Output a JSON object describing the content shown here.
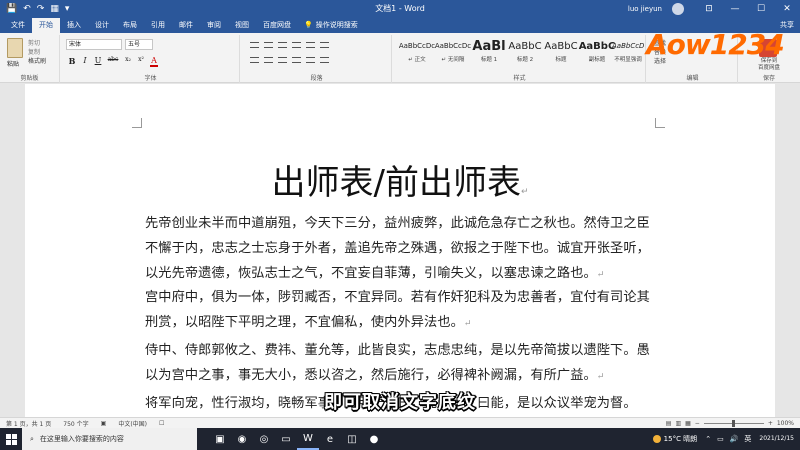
{
  "app": {
    "doc_title": "文档1 - Word",
    "user_name": "luo jieyun"
  },
  "window_buttons": {
    "ribbon_display": "⊡",
    "minimize": "—",
    "maximize": "☐",
    "close": "✕"
  },
  "quick_access": {
    "save": "💾",
    "undo": "↶",
    "redo": "↷",
    "touch": "▦",
    "customize": "▾"
  },
  "tabs": [
    "文件",
    "开始",
    "插入",
    "设计",
    "布局",
    "引用",
    "邮件",
    "审阅",
    "视图",
    "百度网盘"
  ],
  "active_tab": "开始",
  "tell_me": "操作说明搜索",
  "share": "共享",
  "ribbon": {
    "clipboard": {
      "label": "剪贴板",
      "paste": "粘贴",
      "cut": "剪切",
      "copy": "复制",
      "format_painter": "格式刷"
    },
    "font": {
      "label": "字体",
      "font_name": "宋体",
      "font_size": "五号",
      "bold": "B",
      "italic": "I",
      "underline": "U",
      "strike": "abc",
      "sub": "x₂",
      "sup": "x²",
      "clear": "A"
    },
    "paragraph": {
      "label": "段落"
    },
    "styles": {
      "label": "样式",
      "items": [
        {
          "sample": "AaBbCcDc",
          "name": "↵ 正文"
        },
        {
          "sample": "AaBbCcDc",
          "name": "↵ 无间隔"
        },
        {
          "sample": "AaBl",
          "name": "标题 1"
        },
        {
          "sample": "AaBbC",
          "name": "标题 2"
        },
        {
          "sample": "AaBbC",
          "name": "标题"
        },
        {
          "sample": "AaBbC",
          "name": "副标题"
        },
        {
          "sample": "AaBbCcD",
          "name": "不明显强调"
        }
      ]
    },
    "editing": {
      "label": "编辑",
      "find": "查找",
      "replace": "替换",
      "select": "选择"
    },
    "save_group": {
      "label": "保存",
      "button": "保存到\n百度网盘"
    },
    "watermark_logo": "Aow1234"
  },
  "document": {
    "title": "出师表/前出师表",
    "paragraphs": [
      "先帝创业未半而中道崩殂，今天下三分，益州疲弊，此诚危急存亡之秋也。然侍卫之臣不懈于内，忠志之士忘身于外者，盖追先帝之殊遇，欲报之于陛下也。诚宜开张圣听，以光先帝遗德，恢弘志士之气，不宜妄自菲薄，引喻失义，以塞忠谏之路也。",
      "宫中府中，俱为一体，陟罚臧否，不宜异同。若有作奸犯科及为忠善者，宜付有司论其刑赏，以昭陛下平明之理，不宜偏私，使内外异法也。",
      "侍中、侍郎郭攸之、费祎、董允等，此皆良实，志虑忠纯，是以先帝简拔以遗陛下。愚以为宫中之事，事无大小，悉以咨之，然后施行，必得裨补阙漏，有所广益。",
      "将军向宠，性行淑均，晓畅军事，试用于昔日，先帝称之曰能，是以众议举宠为督。"
    ]
  },
  "subtitle": "即可取消文字底纹",
  "statusbar": {
    "page": "第 1 页，共 1 页",
    "words": "750 个字",
    "lang": "中文(中国)",
    "zoom": "100%"
  },
  "taskbar": {
    "search_placeholder": "在这里输入你要搜索的内容",
    "weather": "15°C 晴朗",
    "ime": "英",
    "time": "",
    "date": "2021/12/15"
  }
}
